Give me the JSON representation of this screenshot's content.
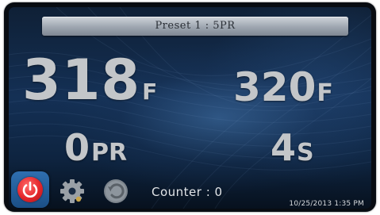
{
  "preset": {
    "label": "Preset 1 : 5PR"
  },
  "readings": {
    "temp_actual": {
      "value": "318",
      "unit": "F"
    },
    "temp_set": {
      "value": "320",
      "unit": "F"
    },
    "pressure": {
      "value": "0",
      "unit": "PR"
    },
    "time": {
      "value": "4",
      "unit": "S"
    }
  },
  "toolbar": {
    "power_icon": "power-icon",
    "settings_icon": "gear-icon",
    "reset_icon": "reset-icon"
  },
  "counter": {
    "text": "Counter : 0"
  },
  "status": {
    "datetime": "10/25/2013 1:35 PM"
  },
  "colors": {
    "power_red": "#e4252a",
    "power_button_blue": "#2f6fb0",
    "reading_gray": "#c3c6c9"
  }
}
